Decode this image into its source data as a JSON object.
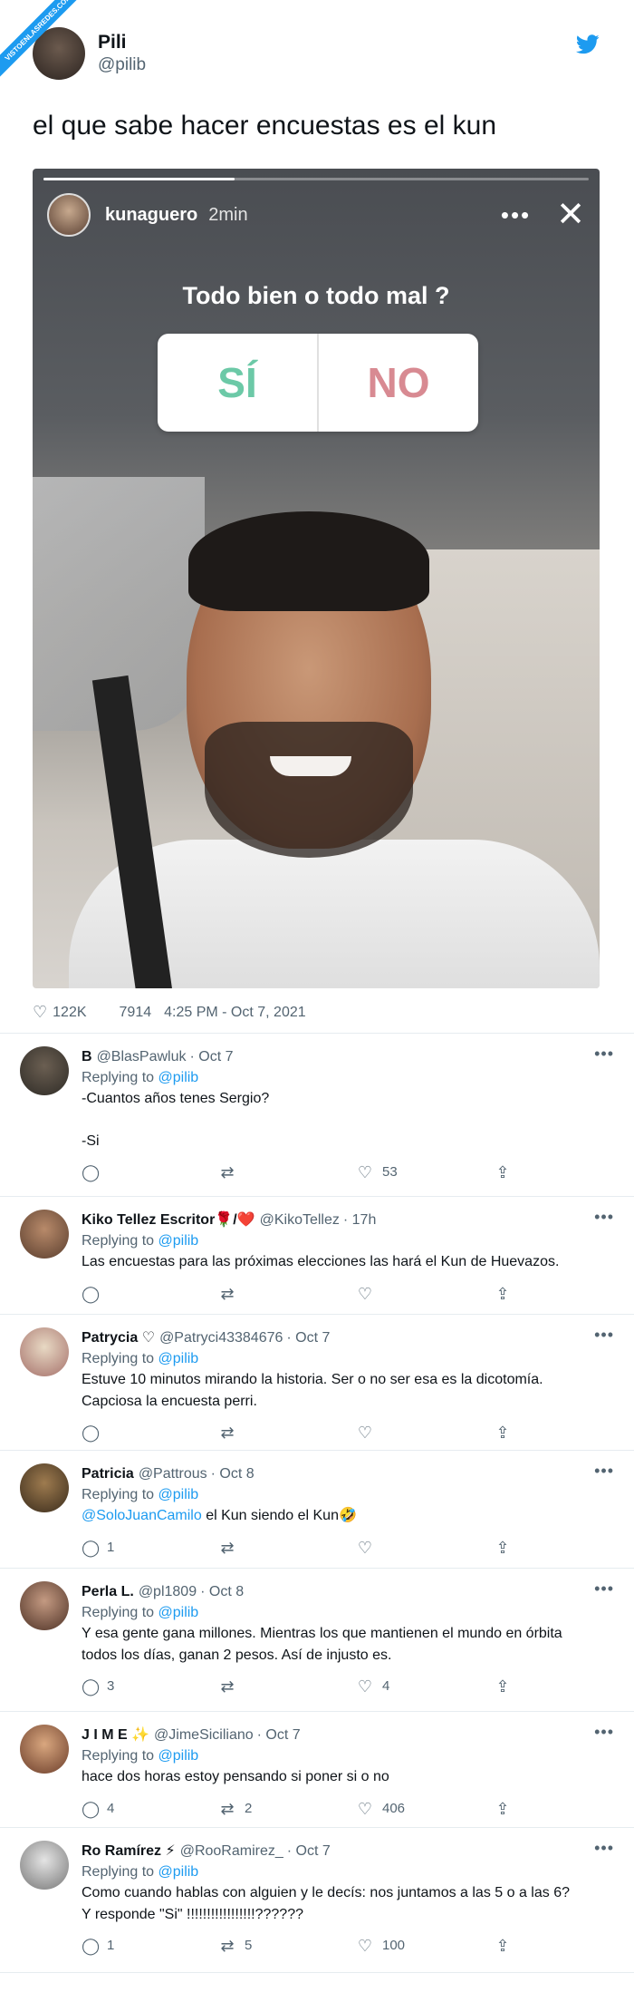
{
  "watermark": "VISTOENLASREDES.COM",
  "main_tweet": {
    "name": "Pili",
    "handle": "@pilib",
    "text": "el que sabe hacer encuestas es el kun",
    "story": {
      "user": "kunaguero",
      "time": "2min",
      "question": "Todo bien o todo mal ?",
      "option_yes": "SÍ",
      "option_no": "NO"
    },
    "likes": "122K",
    "retweets": "7914",
    "timestamp": "4:25 PM - Oct 7, 2021"
  },
  "replies": [
    {
      "name": "B",
      "handle": "@BlasPawluk",
      "time": "· Oct 7",
      "replying_label": "Replying to",
      "replying_to": "@pilib",
      "text": "-Cuantos años tenes Sergio?\n\n-Si",
      "avatar_color": "#6b5f52",
      "avatar_color2": "#2e2b26",
      "replies": "",
      "retweets": "",
      "likes": "53"
    },
    {
      "name": "Kiko Tellez Escritor🌹/❤️",
      "handle": "@KikoTellez",
      "time": "· 17h",
      "replying_label": "Replying to",
      "replying_to": "@pilib",
      "text": "Las encuestas para las próximas elecciones las hará el Kun de Huevazos.",
      "avatar_color": "#b88a6a",
      "avatar_color2": "#5a3e2e",
      "replies": "",
      "retweets": "",
      "likes": ""
    },
    {
      "name": "Patrycia ♡",
      "handle": "@Patryci43384676",
      "time": "· Oct 7",
      "replying_label": "Replying to",
      "replying_to": "@pilib",
      "text": "Estuve 10 minutos mirando la historia. Ser o no ser esa es la dicotomía.\nCapciosa la encuesta perri.",
      "avatar_color": "#e8d9c4",
      "avatar_color2": "#a5706a",
      "replies": "",
      "retweets": "",
      "likes": ""
    },
    {
      "name": "Patricia",
      "handle": "@Pattrous",
      "time": "· Oct 8",
      "replying_label": "Replying to",
      "replying_to": "@pilib",
      "mention": "@SoloJuanCamilo",
      "text": " el Kun siendo el Kun🤣",
      "avatar_color": "#9e7b4f",
      "avatar_color2": "#3a2c1c",
      "replies": "1",
      "retweets": "",
      "likes": ""
    },
    {
      "name": "Perla L.",
      "handle": "@pl1809",
      "time": "· Oct 8",
      "replying_label": "Replying to",
      "replying_to": "@pilib",
      "text": "Y esa gente gana millones. Mientras los que mantienen el mundo en órbita\ntodos los días, ganan 2 pesos. Así de injusto es.",
      "avatar_color": "#c49a82",
      "avatar_color2": "#4e3226",
      "replies": "3",
      "retweets": "",
      "likes": "4"
    },
    {
      "name": "J I M E ✨",
      "handle": "@JimeSiciliano",
      "time": "· Oct 7",
      "replying_label": "Replying to",
      "replying_to": "@pilib",
      "text": "hace dos horas estoy pensando si poner si o no",
      "avatar_color": "#d9a77f",
      "avatar_color2": "#6b3d2a",
      "replies": "4",
      "retweets": "2",
      "likes": "406"
    },
    {
      "name": "Ro Ramírez ⚡",
      "handle": "@RooRamirez_",
      "time": "· Oct 7",
      "replying_label": "Replying to",
      "replying_to": "@pilib",
      "text": "Como cuando hablas con alguien y le decís: nos juntamos a las 5 o a las 6?\nY responde \"Si\" !!!!!!!!!!!!!!!!!??????",
      "avatar_color": "#e4e4e4",
      "avatar_color2": "#777777",
      "replies": "1",
      "retweets": "5",
      "likes": "100"
    }
  ]
}
